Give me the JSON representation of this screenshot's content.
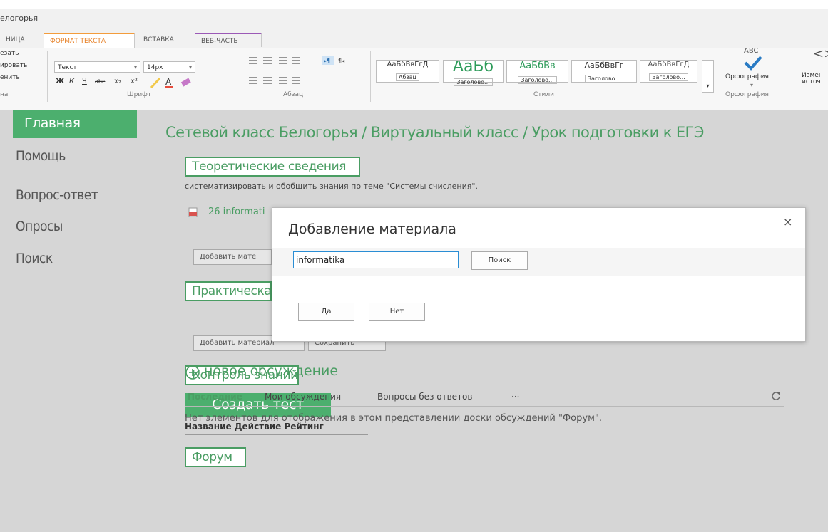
{
  "site_title": "елогорья",
  "tabs": [
    {
      "label": "НИЦА"
    },
    {
      "label": "ФОРМАТ ТЕКСТА"
    },
    {
      "label": "ВСТАВКА"
    },
    {
      "label": "ВЕБ-ЧАСТЬ"
    }
  ],
  "ribbon": {
    "clipboard_items": [
      "езать",
      "ировать",
      "енить"
    ],
    "clipboard_group": "на",
    "font_name": "Текст",
    "font_size": "14px",
    "format_buttons": [
      "Ж",
      "К",
      "Ч",
      "abc",
      "x₂",
      "x²"
    ],
    "font_group": "Шрифт",
    "paragraph_group": "Абзац",
    "styles": [
      {
        "preview": "АаБбВвГгД",
        "name": "Абзац"
      },
      {
        "preview": "АаБб",
        "name": "Заголово..."
      },
      {
        "preview": "АаБбВв",
        "name": "Заголово..."
      },
      {
        "preview": "АаБбВвГг",
        "name": "Заголово..."
      },
      {
        "preview": "АаБбВвГгД",
        "name": "Заголово..."
      }
    ],
    "styles_group": "Стили",
    "spelling_top": "ABC",
    "spelling_label": "Орфография",
    "spelling_group": "Орфография",
    "source_label_1": "Измен",
    "source_label_2": "источ"
  },
  "sidebar": {
    "items": [
      {
        "label": "Главная",
        "active": true
      },
      {
        "label": "Помощь"
      },
      {
        "label": "Вопрос-ответ"
      },
      {
        "label": "Опросы"
      },
      {
        "label": "Поиск"
      }
    ]
  },
  "main": {
    "breadcrumb": "Сетевой класс Белогорья / Виртуальный класс / Урок подготовки к ЕГЭ",
    "theory_title": "Теоретические сведения",
    "theory_desc": "систематизировать и обобщить знания по теме \"Системы счисления\".",
    "file_link": "26 informati",
    "add_material_1": "Добавить мате",
    "practice_title": "Практическа",
    "add_material_2": "Добавить материал",
    "save_button": "Сохранить",
    "control_title": "Контроль знаний",
    "create_test": "Создать тест",
    "table_headers": [
      "Название",
      "Действие",
      "Рейтинг"
    ],
    "forum_title": "Форум",
    "new_discussion": "новое обсуждение",
    "filters": [
      "Последние",
      "Мои обсуждения",
      "Вопросы без ответов",
      "···"
    ],
    "empty_message": "Нет элементов для отображения в этом представлении доски обсуждений \"Форум\"."
  },
  "modal": {
    "title": "Добавление материала",
    "close": "×",
    "search_value": "informatika",
    "search_button": "Поиск",
    "yes_button": "Да",
    "no_button": "Нет"
  },
  "colors": {
    "accent_green": "#4caf6e",
    "tab_orange": "#f39c3c",
    "tab_purple": "#9b59b6",
    "input_focus": "#2a8dd4"
  }
}
